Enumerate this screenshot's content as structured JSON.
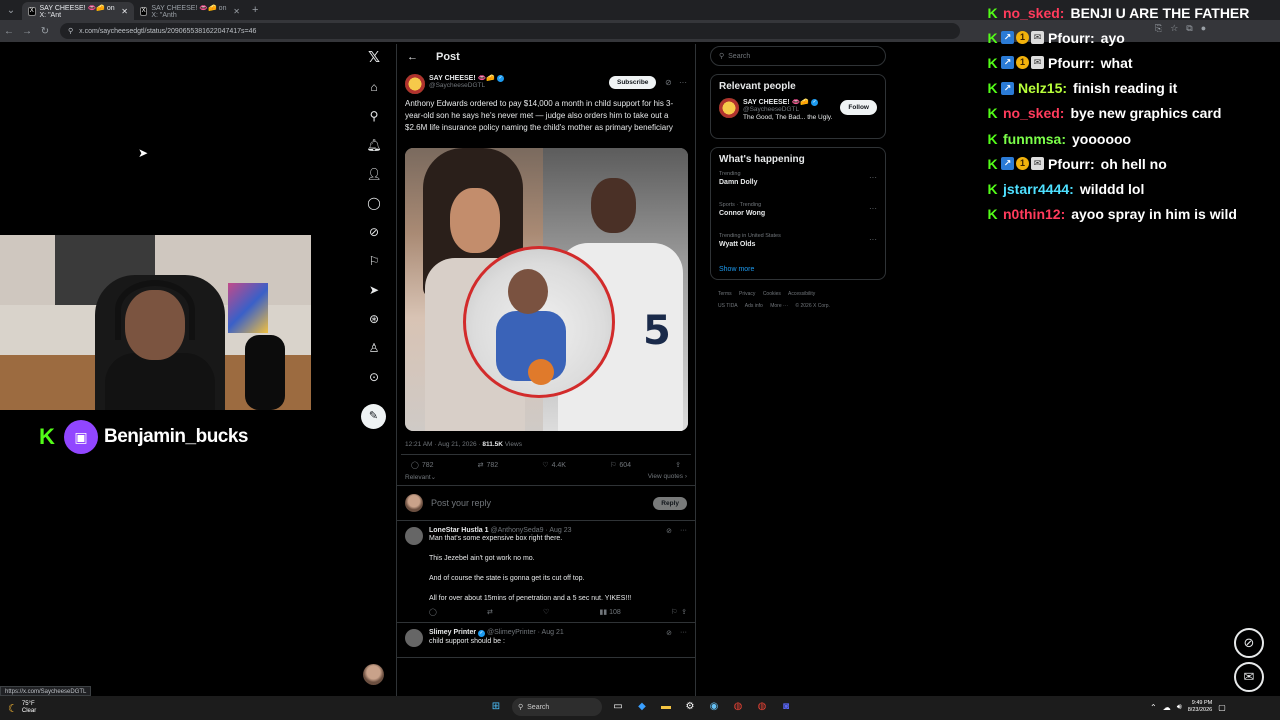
{
  "browser": {
    "tabs": [
      {
        "title": "SAY CHEESE! 👄🧀 on X: \"Ant",
        "active": true
      },
      {
        "title": "SAY CHEESE! 👄🧀 on X: \"Anth",
        "active": false
      }
    ],
    "url": "x.com/saycheesedgtl/status/2090655381622047417s=46",
    "status_link": "https://x.com/SaycheeseDGTL"
  },
  "x_nav": {
    "items": [
      "home",
      "explore",
      "notifications",
      "follow",
      "messages",
      "grok",
      "bookmarks",
      "communities",
      "premium",
      "profile",
      "more"
    ]
  },
  "post": {
    "header": "Post",
    "author_name": "SAY CHEESE! 👄🧀",
    "author_handle": "@SaycheeseDGTL",
    "subscribe_label": "Subscribe",
    "text": "Anthony Edwards ordered to pay $14,000 a month in child support for his 3-year-old son he says he's never met — judge also orders him to take out a $2.6M life insurance policy naming the child's mother as primary beneficiary",
    "jersey_number": "5",
    "timestamp": "12:21 AM · Aug 21, 2026 · ",
    "views_count": "811.5K",
    "views_label": " Views",
    "replies": "782",
    "reposts": "782",
    "likes": "4.4K",
    "bookmarks": "604",
    "sort_label": "Relevant",
    "view_quotes": "View quotes",
    "reply_placeholder": "Post your reply",
    "reply_button": "Reply"
  },
  "replies": [
    {
      "name": "LoneStar Hustla 1",
      "handle": "@AnthonySeda9 · Aug 23",
      "lines": [
        "Man that's some expensive box right there.",
        "This Jezebel ain't got work no mo.",
        "And of course the state is gonna get its cut off top.",
        "All for over about 15mins of penetration and a 5 sec nut. YIKES!!!"
      ],
      "views": "108"
    },
    {
      "name": "Slimey Printer",
      "handle": "@SlimeyPrinter · Aug 21",
      "lines": [
        "child support should be :"
      ]
    }
  ],
  "sidebar": {
    "search_placeholder": "Search",
    "relevant_title": "Relevant people",
    "person_name": "SAY CHEESE! 👄🧀",
    "person_handle": "@SaycheeseDGTL",
    "person_bio": "The Good, The Bad... the Ugly.",
    "follow_label": "Follow",
    "happening_title": "What's happening",
    "trends": [
      {
        "context": "Trending",
        "name": "Damn Dolly"
      },
      {
        "context": "Sports · Trending",
        "name": "Connor Wong"
      },
      {
        "context": "Trending in United States",
        "name": "Wyatt Olds"
      }
    ],
    "show_more": "Show more",
    "footer_line1": [
      "Terms",
      "Privacy",
      "Cookies",
      "Accessibility"
    ],
    "footer_line2": [
      "US TIDA",
      "Ads info",
      "More ···",
      "© 2026 X Corp."
    ]
  },
  "streamer": {
    "name": "Benjamin_bucks"
  },
  "chat": [
    {
      "user": "no_sked:",
      "color": "#ff3b5c",
      "badges": [],
      "text": "BENJI U ARE THE FATHER"
    },
    {
      "user": "Pfourr:",
      "color": "#ffffff",
      "badges": [
        "blue",
        "gold",
        "mail"
      ],
      "text": "ayo"
    },
    {
      "user": "Pfourr:",
      "color": "#ffffff",
      "badges": [
        "blue",
        "gold",
        "mail"
      ],
      "text": "what"
    },
    {
      "user": "Nelz15:",
      "color": "#b8ff3b",
      "badges": [
        "blue"
      ],
      "text": "finish reading it"
    },
    {
      "user": "no_sked:",
      "color": "#ff3b5c",
      "badges": [],
      "text": "bye new graphics card"
    },
    {
      "user": "funnmsa:",
      "color": "#7cff4a",
      "badges": [],
      "text": "yoooooo"
    },
    {
      "user": "Pfourr:",
      "color": "#ffffff",
      "badges": [
        "blue",
        "gold",
        "mail"
      ],
      "text": "oh hell no"
    },
    {
      "user": "jstarr4444:",
      "color": "#4ee0ff",
      "badges": [],
      "text": "wilddd lol"
    },
    {
      "user": "n0thin12:",
      "color": "#ff3b5c",
      "badges": [],
      "text": "ayoo spray in him is wild"
    }
  ],
  "taskbar": {
    "temp": "75°F",
    "condition": "Clear",
    "search_label": "Search",
    "time": "9:49 PM",
    "date": "8/23/2026"
  }
}
